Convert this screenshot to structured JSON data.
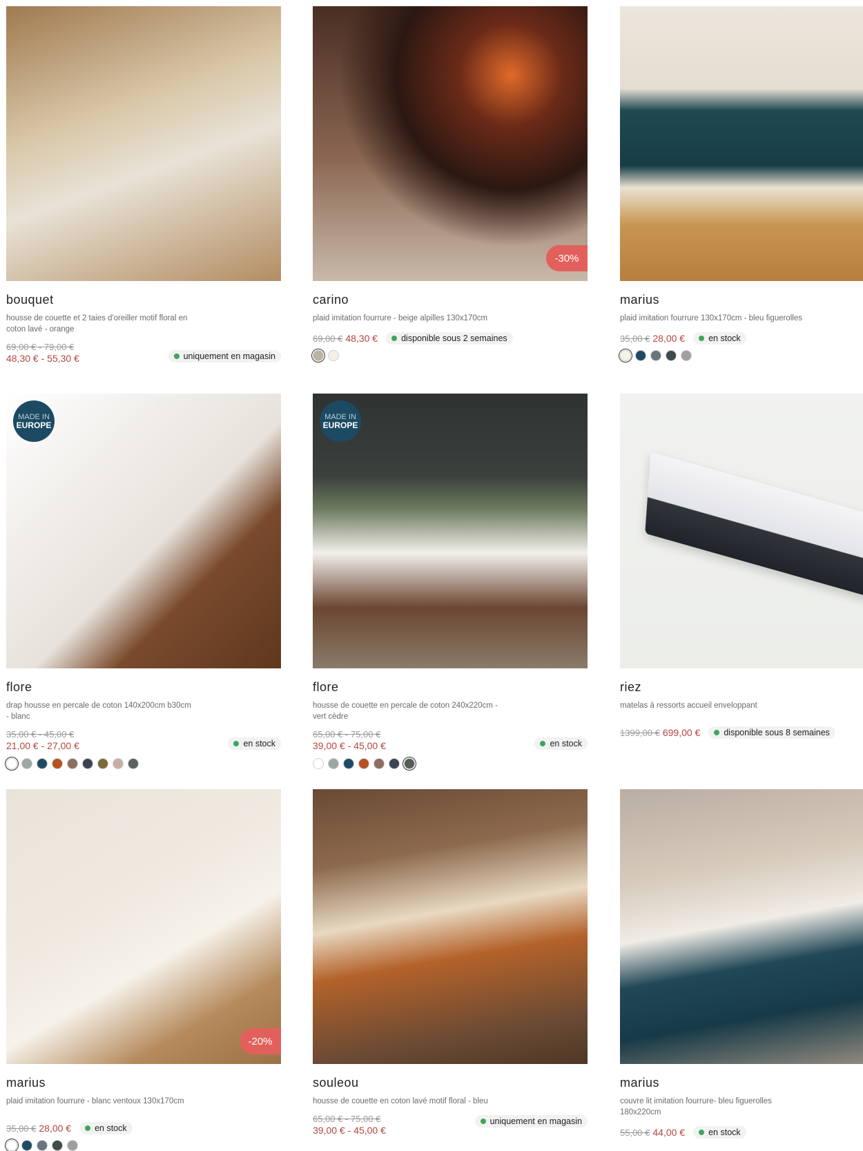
{
  "products": [
    {
      "name": "bouquet",
      "description": "housse de couette et 2 taies d'oreiller motif floral en coton lavé - orange",
      "old_price": "69,00 € - 79,00 €",
      "new_price": "48,30 € - 55,30 €",
      "status": "uniquement en magasin",
      "colors": []
    },
    {
      "name": "carino",
      "description": "plaid imitation fourrure - beige alpilles 130x170cm",
      "old_price": "69,00 €",
      "new_price": "48,30 €",
      "status": "disponible sous 2 semaines",
      "discount": "-30%",
      "colors": [
        "#b9b4a4",
        "#f4f1e8"
      ]
    },
    {
      "name": "marius",
      "description": "plaid imitation fourrure 130x170cm - bleu figuerolles",
      "old_price": "35,00 €",
      "new_price": "28,00 €",
      "status": "en stock",
      "colors": [
        "#f5f2e6",
        "#1f4a63",
        "#6a747a",
        "#3e4b49",
        "#9fa09b"
      ]
    },
    {
      "name": "flore",
      "description": "drap housse en percale de coton 140x200cm b30cm - blanc",
      "old_price": "35,00 € - 45,00 €",
      "new_price": "21,00 € - 27,00 €",
      "status": "en stock",
      "badge": {
        "line1": "MADE IN",
        "line2": "EUROPE"
      },
      "colors": [
        "#ffffff",
        "#9aa7a4",
        "#1f4a63",
        "#b8501f",
        "#8e6d62",
        "#3d4451",
        "#7a6a3c",
        "#c7aea4",
        "#5d615f"
      ]
    },
    {
      "name": "flore",
      "description": "housse de couette en percale de coton 240x220cm - vert cèdre",
      "old_price": "65,00 € - 75,00 €",
      "new_price": "39,00 € - 45,00 €",
      "status": "en stock",
      "badge": {
        "line1": "MADE IN",
        "line2": "EUROPE"
      },
      "colors": [
        "#ffffff",
        "#9aa7a4",
        "#1f4a63",
        "#b8501f",
        "#8e6d62",
        "#3d4451",
        "#555c54"
      ]
    },
    {
      "name": "riez",
      "description": "matelas à ressorts accueil enveloppant",
      "old_price": "1399,00 €",
      "new_price": "699,00 €",
      "status": "disponible sous 8 semaines",
      "colors": []
    },
    {
      "name": "marius",
      "description": "plaid imitation fourrure - blanc ventoux 130x170cm",
      "old_price": "35,00 €",
      "new_price": "28,00 €",
      "status": "en stock",
      "discount": "-20%",
      "colors": [
        "#ffffff",
        "#1f4a63",
        "#6a747a",
        "#3e4b49",
        "#9fa09b"
      ]
    },
    {
      "name": "souleou",
      "description": "housse de couette en coton lavé motif floral - bleu",
      "old_price": "65,00 € - 75,00 €",
      "new_price": "39,00 € - 45,00 €",
      "status": "uniquement en magasin",
      "colors": []
    },
    {
      "name": "marius",
      "description": "couvre lit imitation fourrure- bleu figuerolles 180x220cm",
      "old_price": "55,00 €",
      "new_price": "44,00 €",
      "status": "en stock",
      "colors": []
    }
  ],
  "colors": {
    "sale_price": "#b4453d",
    "discount_badge": "#e2605b",
    "stock_dot": "#3fa55c",
    "made_in_badge": "#1c4a63"
  }
}
